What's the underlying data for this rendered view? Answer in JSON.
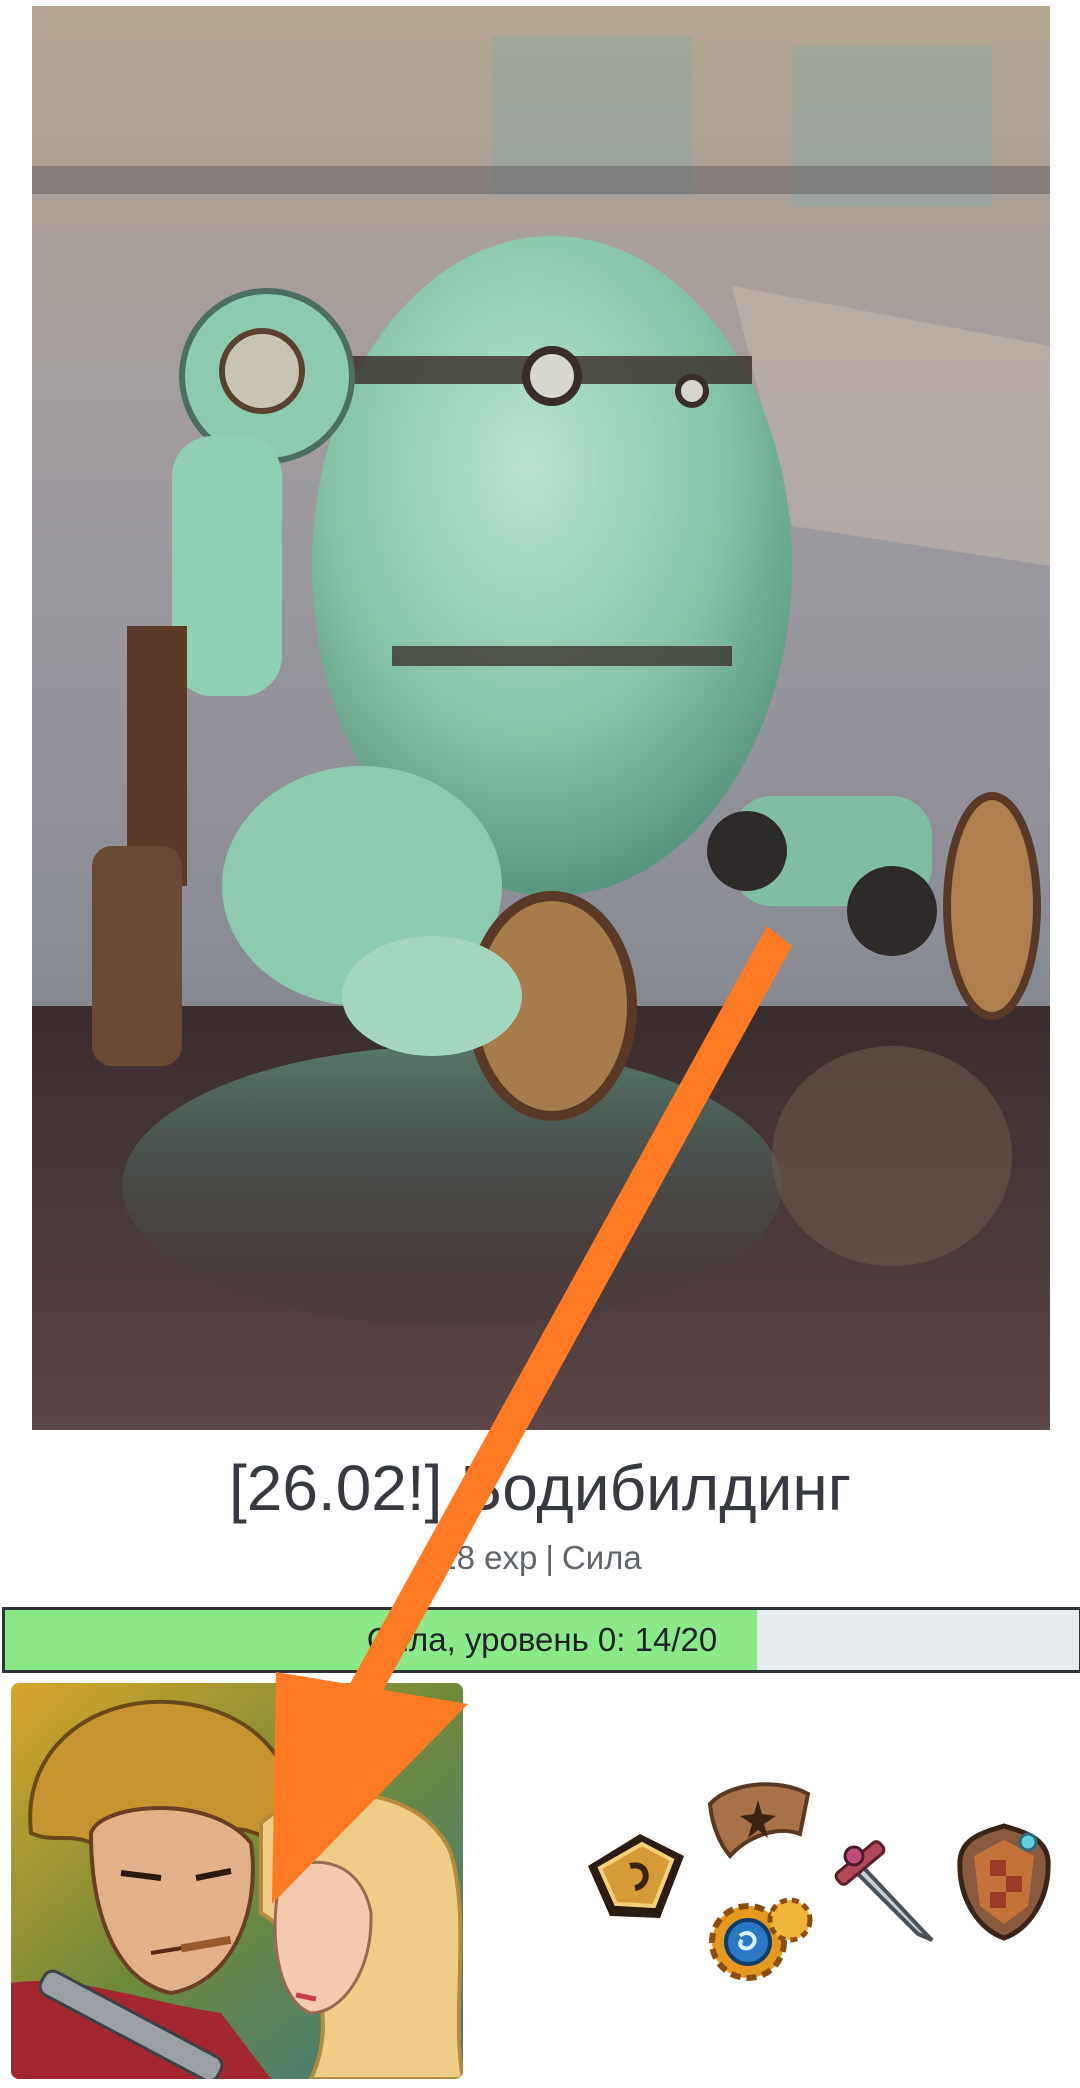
{
  "quest": {
    "title": "[26.02!] Бодибилдинг",
    "exp": "28 exp",
    "separator": "|",
    "category": "Сила"
  },
  "progress": {
    "label": "Сила, уровень 0: 14/20",
    "current": 14,
    "max": 20,
    "fill_color": "#8ce98a",
    "track_color": "#e8ebee"
  },
  "images": {
    "hero": "rusty-robot-photo",
    "avatar": "anime-hero-avatar"
  },
  "inventory": {
    "items": [
      "bracer-icon",
      "scroll-map-icon",
      "gear-orb-icon",
      "sword-icon",
      "shield-icon"
    ]
  },
  "annotation": {
    "arrow_color": "#ff7a22"
  }
}
